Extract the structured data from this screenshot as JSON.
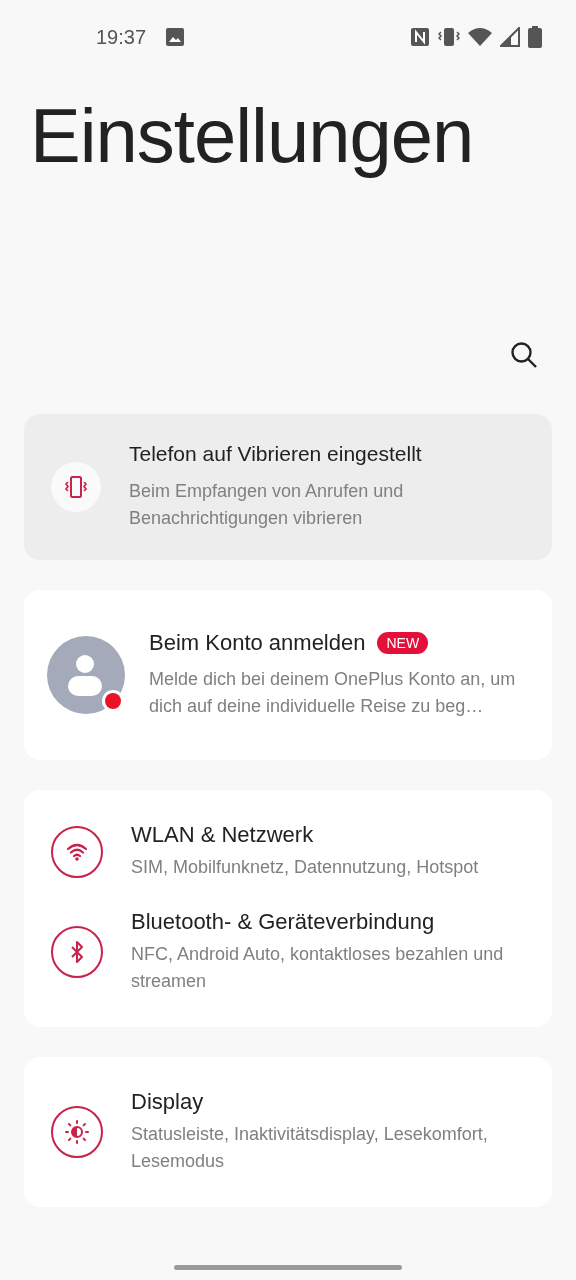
{
  "status_bar": {
    "time": "19:37"
  },
  "title": "Einstellungen",
  "notice": {
    "title": "Telefon auf Vibrieren eingestellt",
    "subtitle": "Beim Empfangen von Anrufen und Benachrichtigungen vibrieren"
  },
  "account": {
    "title": "Beim Konto anmelden",
    "badge": "NEW",
    "subtitle": "Melde dich bei deinem OnePlus Konto an, um dich auf deine individuelle Reise zu beg…"
  },
  "groups": [
    {
      "items": [
        {
          "kind": "wifi",
          "title": "WLAN & Netzwerk",
          "subtitle": "SIM, Mobilfunknetz, Datennutzung, Hotspot"
        },
        {
          "kind": "bluetooth",
          "title": "Bluetooth- & Geräteverbindung",
          "subtitle": "NFC, Android Auto, kontaktloses bezahlen und streamen"
        }
      ]
    },
    {
      "items": [
        {
          "kind": "display",
          "title": "Display",
          "subtitle": "Statusleiste, Inaktivitätsdisplay, Lesekomfort, Lesemodus"
        }
      ]
    }
  ]
}
